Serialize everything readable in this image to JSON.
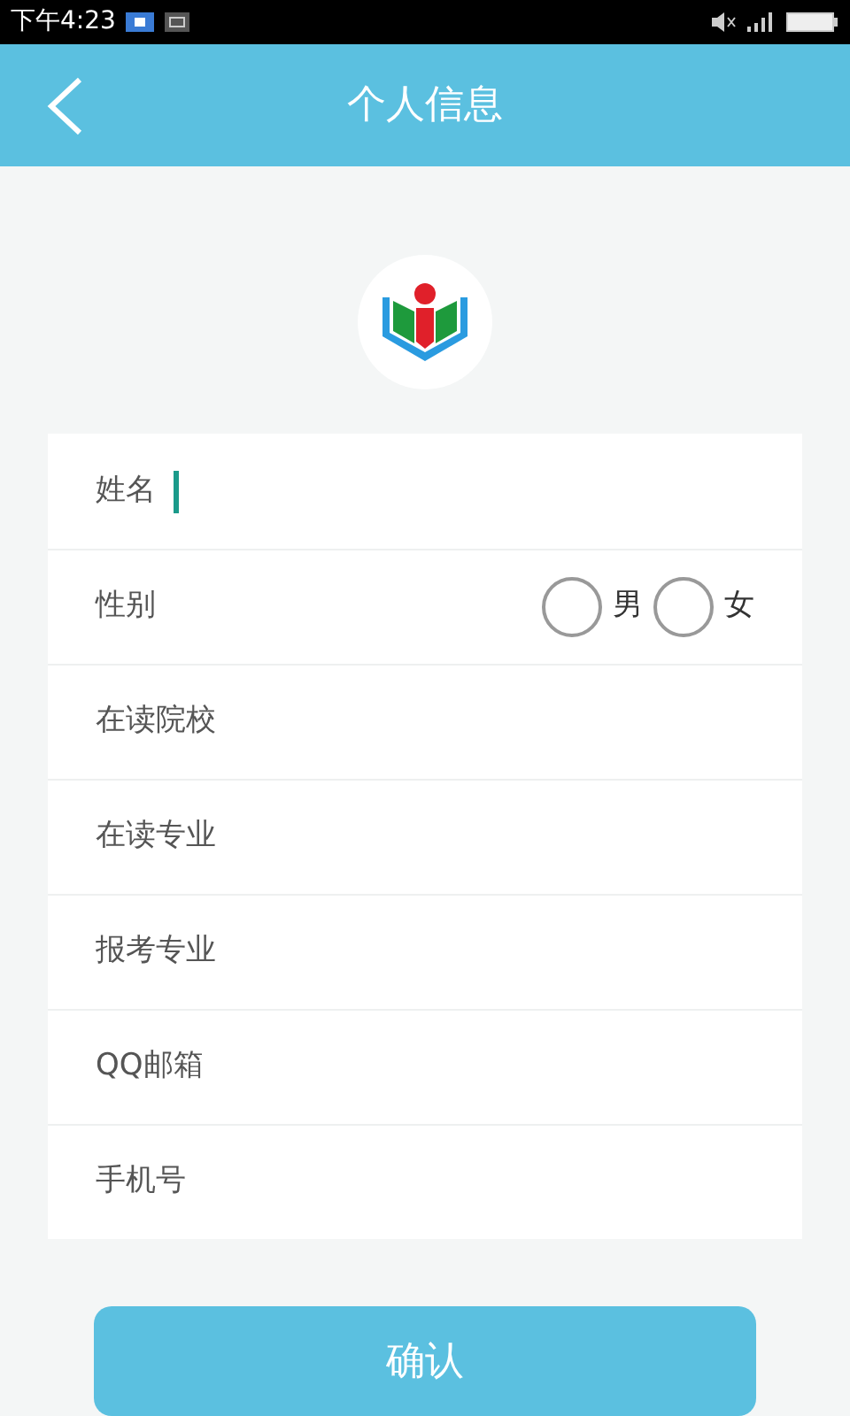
{
  "status_bar": {
    "time": "下午4:23"
  },
  "header": {
    "title": "个人信息"
  },
  "form": {
    "rows": [
      {
        "kind": "text",
        "label": "姓名",
        "focused": true
      },
      {
        "kind": "radio",
        "label": "性别",
        "options": [
          {
            "label": "男",
            "selected": false
          },
          {
            "label": "女",
            "selected": false
          }
        ]
      },
      {
        "kind": "text",
        "label": "在读院校",
        "focused": false
      },
      {
        "kind": "text",
        "label": "在读专业",
        "focused": false
      },
      {
        "kind": "text",
        "label": "报考专业",
        "focused": false
      },
      {
        "kind": "text",
        "label": "QQ邮箱",
        "focused": false
      },
      {
        "kind": "text",
        "label": "手机号",
        "focused": false
      }
    ]
  },
  "confirm_button": {
    "label": "确认"
  }
}
